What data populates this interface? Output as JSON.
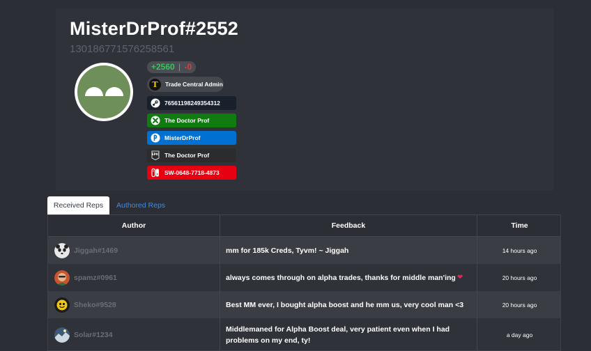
{
  "profile": {
    "username": "MisterDrProf#2552",
    "user_id": "130186771576258561",
    "rep_positive": "+2560",
    "rep_separator": "|",
    "rep_negative": "-0",
    "role_badge": "Trade Central Admin",
    "accounts": {
      "steam": "76561198249354312",
      "xbox": "The Doctor Prof",
      "psn": "MisterDrProf",
      "epic": "The Doctor Prof",
      "nintendo": "SW-0648-7718-4873"
    }
  },
  "tabs": {
    "received": "Received Reps",
    "authored": "Authored Reps"
  },
  "table": {
    "headers": {
      "author": "Author",
      "feedback": "Feedback",
      "time": "Time"
    },
    "rows": [
      {
        "author": "Jiggah#1469",
        "feedback": "mm for 185k Creds, Tyvm! ~ Jiggah",
        "time": "14 hours ago"
      },
      {
        "author": "spamz#0961",
        "feedback": "always comes through on alpha trades, thanks for middle man'ing",
        "time": "20 hours ago"
      },
      {
        "author": "Sheko#9528",
        "feedback": "Best MM ever, I bought alpha boost and he mm us, very cool man <3",
        "time": "20 hours ago"
      },
      {
        "author": "Solar#1234",
        "feedback": "Middlemaned for Alpha Boost deal, very patient even when I had problems on my end, ty!",
        "time": "a day ago"
      }
    ]
  }
}
